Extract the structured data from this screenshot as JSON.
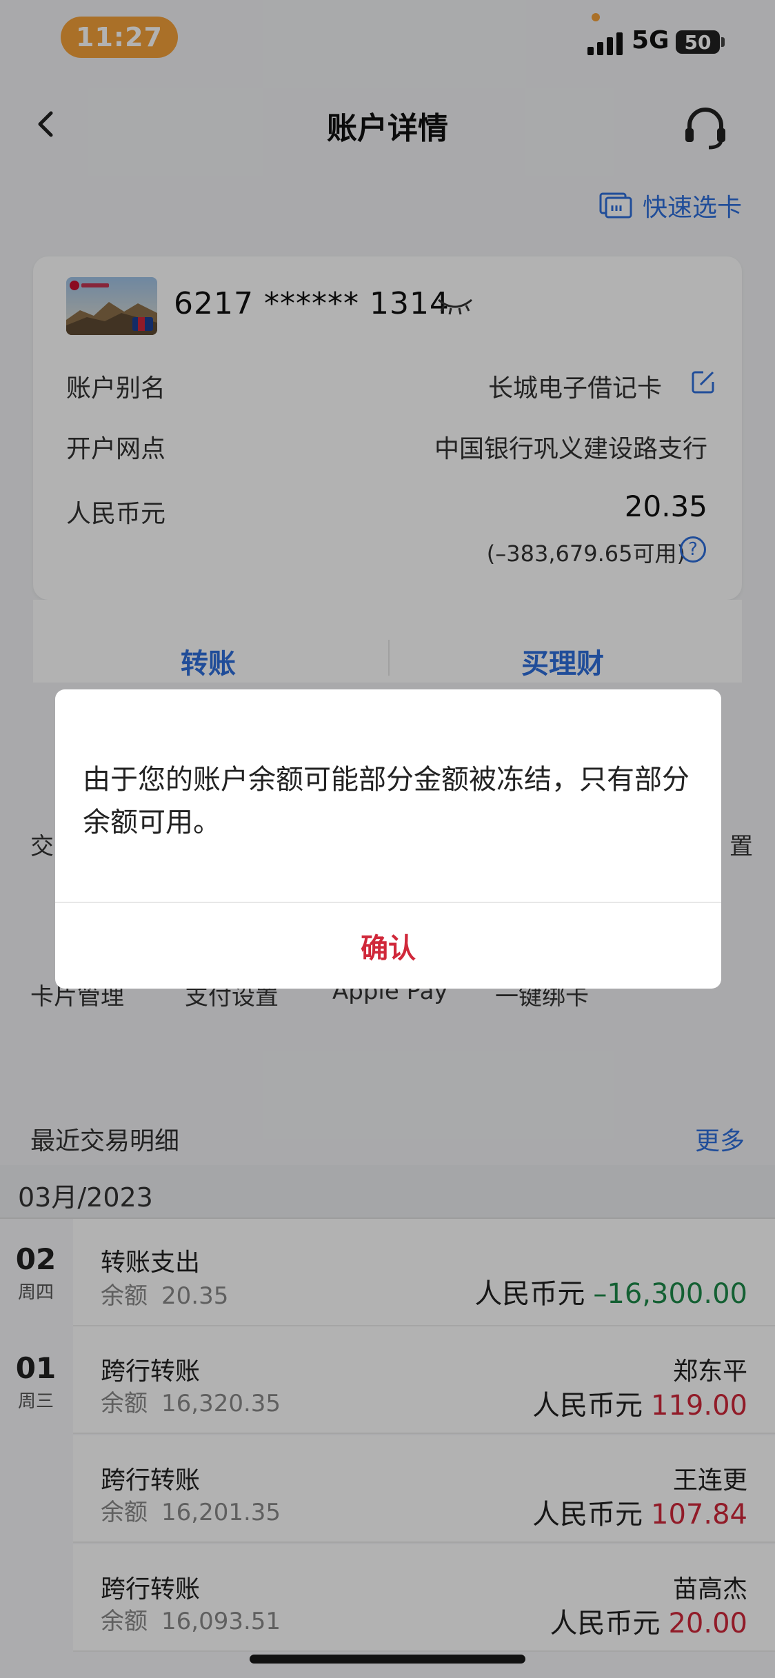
{
  "status_bar": {
    "time": "11:27",
    "network": "5G",
    "battery": "50"
  },
  "nav": {
    "title": "账户详情"
  },
  "quick_card": {
    "label": "快速选卡"
  },
  "account": {
    "card_number": "6217 ****** 1314",
    "rows": [
      {
        "label": "账户别名",
        "value": "长城电子借记卡"
      },
      {
        "label": "开户网点",
        "value": "中国银行巩义建设路支行"
      },
      {
        "label": "人民币元",
        "value": "20.35"
      }
    ],
    "available": "(–383,679.65可用)"
  },
  "actions": {
    "transfer": "转账",
    "buy_finance": "买理财"
  },
  "functions": {
    "row1_left": "交",
    "row1_right": "置",
    "row2": [
      "卡片管理",
      "支付设置",
      "Apple Pay",
      "一键绑卡"
    ]
  },
  "recent": {
    "title": "最近交易明细",
    "more": "更多",
    "month": "03月/2023",
    "transactions": [
      {
        "day": "02",
        "weekday": "周四",
        "title": "转账支出",
        "balance_label": "余额",
        "balance": "20.35",
        "payee": "",
        "currency": "人民币元",
        "amount": "–16,300.00",
        "direction": "out"
      },
      {
        "day": "01",
        "weekday": "周三",
        "title": "跨行转账",
        "balance_label": "余额",
        "balance": "16,320.35",
        "payee": "郑东平",
        "currency": "人民币元",
        "amount": "119.00",
        "direction": "in"
      },
      {
        "day": "",
        "weekday": "",
        "title": "跨行转账",
        "balance_label": "余额",
        "balance": "16,201.35",
        "payee": "王连更",
        "currency": "人民币元",
        "amount": "107.84",
        "direction": "in"
      },
      {
        "day": "",
        "weekday": "",
        "title": "跨行转账",
        "balance_label": "余额",
        "balance": "16,093.51",
        "payee": "苗高杰",
        "currency": "人民币元",
        "amount": "20.00",
        "direction": "in"
      }
    ]
  },
  "dialog": {
    "message": "由于您的账户余额可能部分金额被冻结，只有部分余额可用。",
    "confirm": "确认"
  },
  "colors": {
    "accent_blue": "#2f6fdc",
    "status_orange": "#f4a13a",
    "amount_red": "#d0283a",
    "amount_green": "#1e8a4a"
  }
}
